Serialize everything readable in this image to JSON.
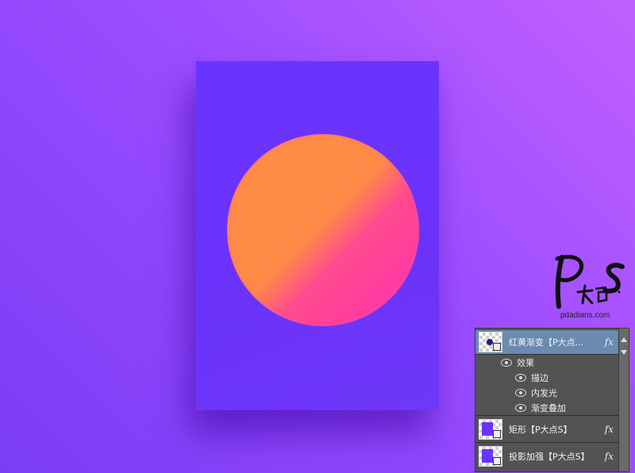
{
  "watermark": {
    "logo_text": "PS大点S",
    "url": "pdadians.com"
  },
  "layers_panel": {
    "layers": [
      {
        "name": "红黄渐变【P大点...",
        "fx": "fx",
        "selected": true
      },
      {
        "name": "矩形【P大点S】",
        "fx": "fx",
        "selected": false
      },
      {
        "name": "投影加强【P大点S】",
        "fx": "fx",
        "selected": false
      }
    ],
    "effects_header": "效果",
    "effects": [
      "描边",
      "内发光",
      "渐变叠加"
    ]
  },
  "colors": {
    "background_light": "#c160ff",
    "background_dark": "#7c3cf6",
    "poster": "#6a34ff",
    "sun_orange": "#ff8e45",
    "sun_pink": "#ff2fb3",
    "panel": "#535353",
    "selected_row": "#6a8ab0"
  }
}
